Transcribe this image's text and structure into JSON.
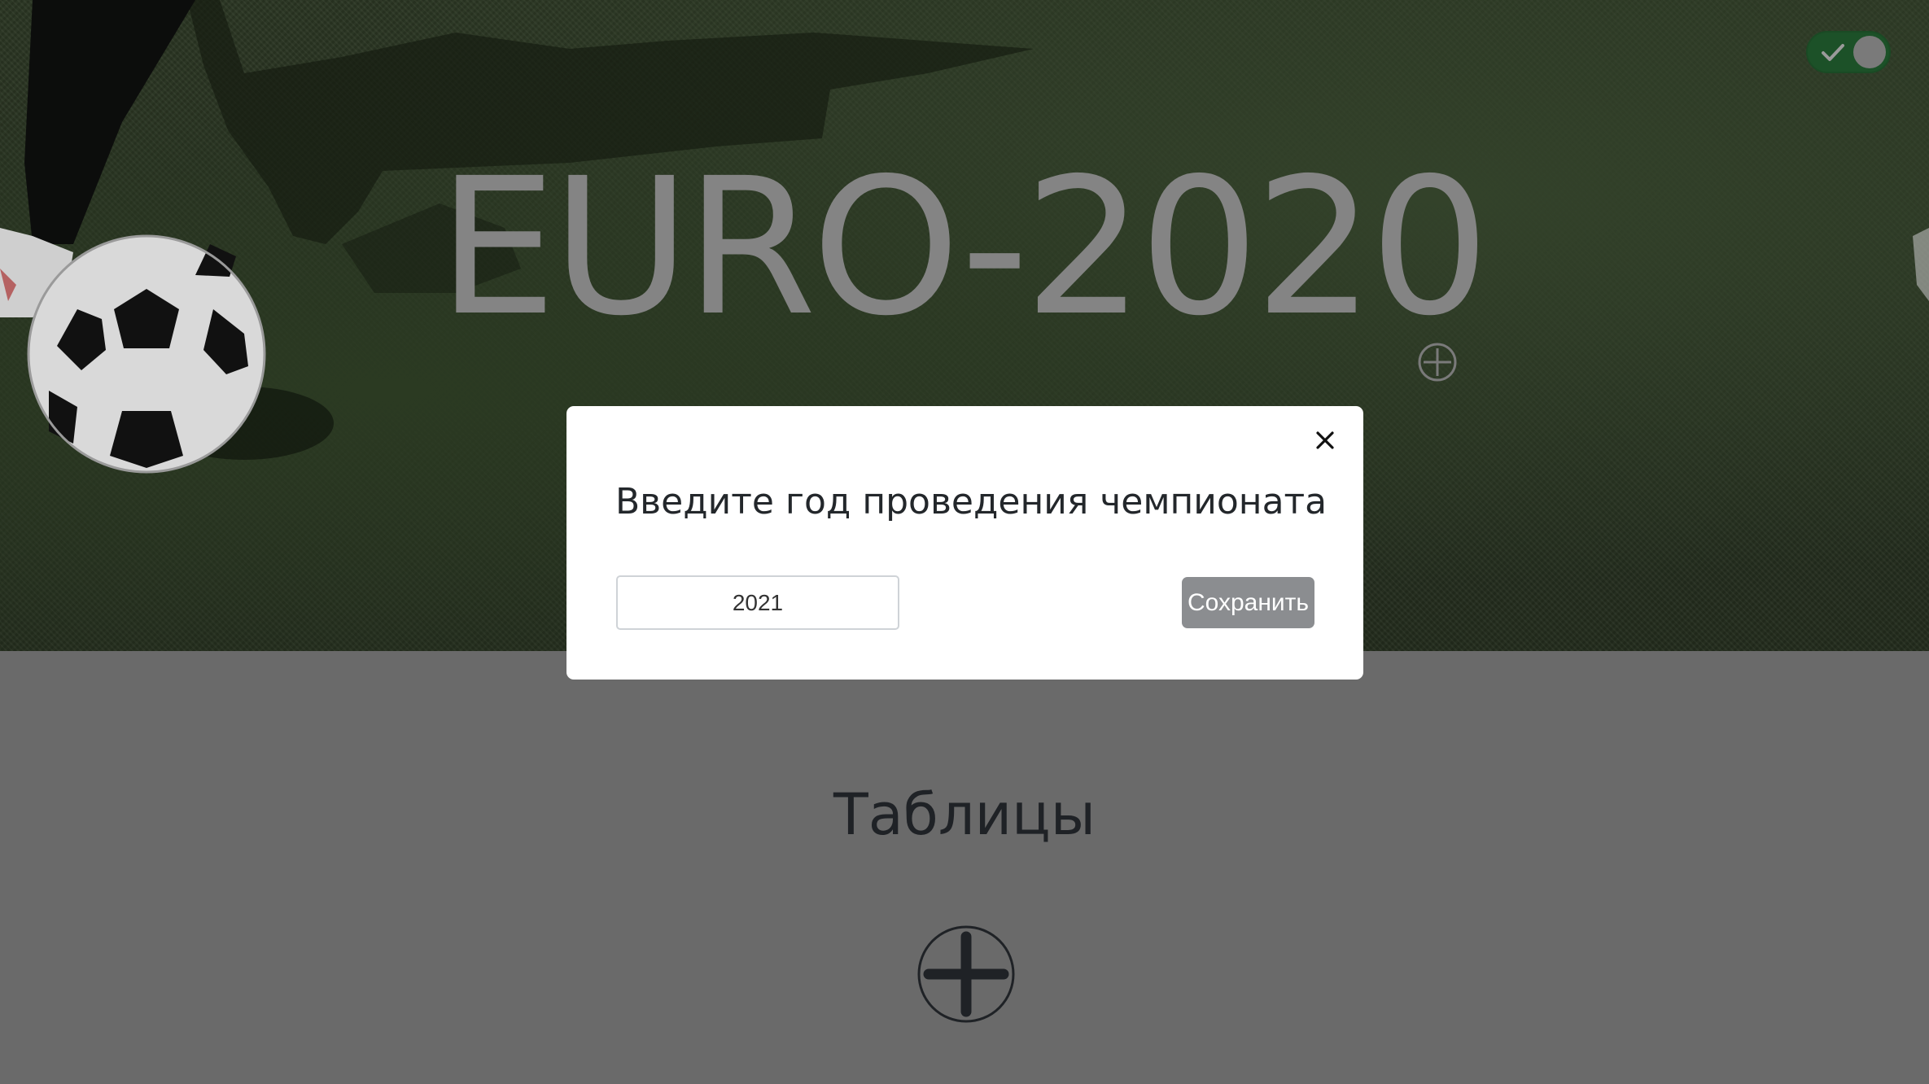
{
  "hero": {
    "title": "EURO-2020",
    "add_icon": "circle-plus-icon"
  },
  "toggle": {
    "state": "on",
    "icon": "check-icon",
    "accent_color": "#1c5128"
  },
  "section": {
    "title": "Таблицы",
    "add_icon": "circle-plus-icon"
  },
  "modal": {
    "title": "Введите год проведения чемпионата",
    "input_value": "2021",
    "save_label": "Сохранить",
    "close_icon": "close-icon"
  }
}
